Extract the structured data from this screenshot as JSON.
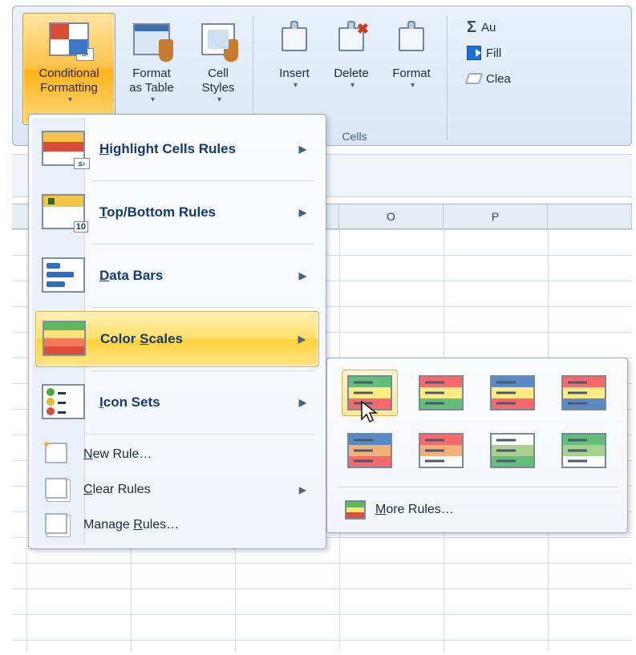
{
  "ribbon": {
    "buttons": {
      "conditional_formatting": "Conditional\nFormatting",
      "format_as_table": "Format\nas Table",
      "cell_styles": "Cell\nStyles",
      "insert": "Insert",
      "delete": "Delete",
      "format": "Format",
      "autosum": "Au",
      "fill": "Fill",
      "clear": "Clea"
    },
    "group_cells_label": "Cells"
  },
  "columns": [
    "O",
    "P"
  ],
  "context_menu": {
    "items": [
      {
        "label": "Highlight Cells Rules",
        "accel_index": 0
      },
      {
        "label": "Top/Bottom Rules",
        "accel_index": 0
      },
      {
        "label": "Data Bars",
        "accel_index": 0
      },
      {
        "label": "Color Scales",
        "accel_index": 6
      },
      {
        "label": "Icon Sets",
        "accel_index": 0
      }
    ],
    "actions": {
      "new_rule": "New Rule…",
      "clear_rules": "Clear Rules",
      "manage": "Manage Rules…"
    },
    "hovered": "Color Scales"
  },
  "color_scales_gallery": {
    "presets": [
      {
        "name": "green-yellow-red",
        "colors": [
          "#63be7b",
          "#ffeb84",
          "#f8696b"
        ],
        "selected": true
      },
      {
        "name": "red-yellow-green",
        "colors": [
          "#f8696b",
          "#ffeb84",
          "#63be7b"
        ]
      },
      {
        "name": "blue-yellow-red",
        "colors": [
          "#5a8ac6",
          "#ffeb84",
          "#f8696b"
        ]
      },
      {
        "name": "red-yellow-blue",
        "colors": [
          "#f8696b",
          "#ffeb84",
          "#5a8ac6"
        ]
      },
      {
        "name": "blue-white-red",
        "colors": [
          "#5a8ac6",
          "#f2b179",
          "#f8696b"
        ]
      },
      {
        "name": "red-orange-white",
        "colors": [
          "#f8696b",
          "#f2b179",
          "#fcfcff"
        ]
      },
      {
        "name": "white-green",
        "colors": [
          "#fcfcff",
          "#a9d08e",
          "#63be7b"
        ]
      },
      {
        "name": "green-white",
        "colors": [
          "#63be7b",
          "#a9d08e",
          "#fcfcff"
        ]
      }
    ],
    "more_rules_label": "More Rules…"
  }
}
